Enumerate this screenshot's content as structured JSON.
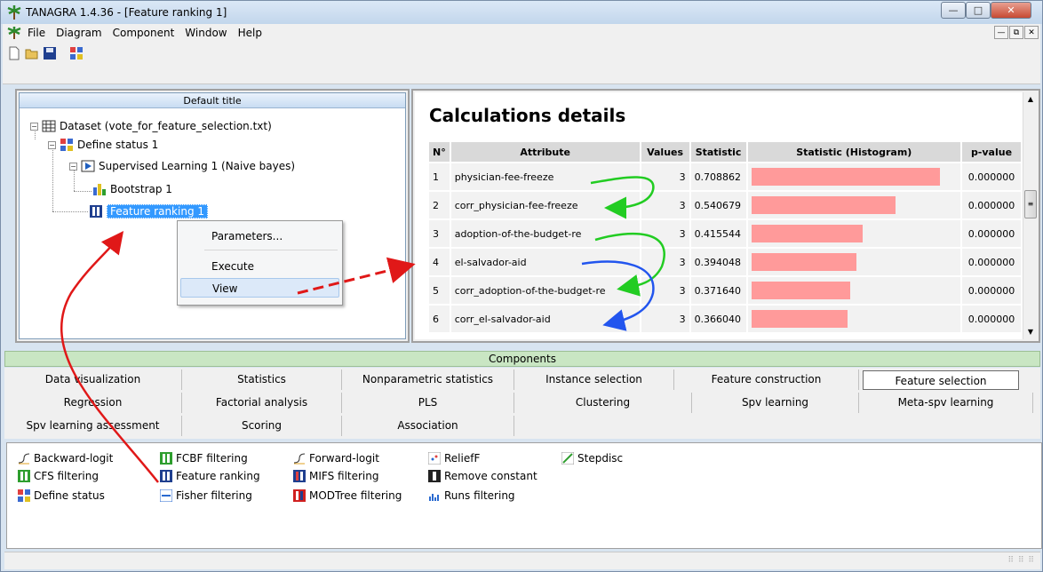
{
  "window": {
    "title": "TANAGRA 1.4.36 - [Feature ranking 1]"
  },
  "menu": {
    "items": [
      "File",
      "Diagram",
      "Component",
      "Window",
      "Help"
    ]
  },
  "tree": {
    "header": "Default title",
    "nodes": [
      {
        "label": "Dataset (vote_for_feature_selection.txt)"
      },
      {
        "label": "Define status 1"
      },
      {
        "label": "Supervised Learning 1 (Naive bayes)"
      },
      {
        "label": "Bootstrap 1"
      },
      {
        "label": "Feature ranking 1"
      }
    ]
  },
  "context_menu": {
    "items": [
      "Parameters...",
      "Execute",
      "View"
    ]
  },
  "details": {
    "title": "Calculations details",
    "columns": [
      "N°",
      "Attribute",
      "Values",
      "Statistic",
      "Statistic (Histogram)",
      "p-value"
    ],
    "rows": [
      {
        "n": "1",
        "attribute": "physician-fee-freeze",
        "values": "3",
        "statistic": "0.708862",
        "hist_fraction": 0.92,
        "pvalue": "0.000000"
      },
      {
        "n": "2",
        "attribute": "corr_physician-fee-freeze",
        "values": "3",
        "statistic": "0.540679",
        "hist_fraction": 0.7,
        "pvalue": "0.000000"
      },
      {
        "n": "3",
        "attribute": "adoption-of-the-budget-re",
        "values": "3",
        "statistic": "0.415544",
        "hist_fraction": 0.54,
        "pvalue": "0.000000"
      },
      {
        "n": "4",
        "attribute": "el-salvador-aid",
        "values": "3",
        "statistic": "0.394048",
        "hist_fraction": 0.51,
        "pvalue": "0.000000"
      },
      {
        "n": "5",
        "attribute": "corr_adoption-of-the-budget-re",
        "values": "3",
        "statistic": "0.371640",
        "hist_fraction": 0.48,
        "pvalue": "0.000000"
      },
      {
        "n": "6",
        "attribute": "corr_el-salvador-aid",
        "values": "3",
        "statistic": "0.366040",
        "hist_fraction": 0.47,
        "pvalue": "0.000000"
      }
    ]
  },
  "components": {
    "header": "Components",
    "tabs_row1": [
      "Data visualization",
      "Statistics",
      "Nonparametric statistics",
      "Instance selection",
      "Feature construction",
      "Feature selection"
    ],
    "tabs_row2": [
      "Regression",
      "Factorial analysis",
      "PLS",
      "Clustering",
      "Spv learning",
      "Meta-spv learning"
    ],
    "tabs_row3": [
      "Spv learning assessment",
      "Scoring",
      "Association"
    ],
    "items": [
      "Backward-logit",
      "CFS filtering",
      "Define status",
      "FCBF filtering",
      "Feature ranking",
      "Fisher filtering",
      "Forward-logit",
      "MIFS filtering",
      "MODTree filtering",
      "ReliefF",
      "Remove constant",
      "Runs filtering",
      "Stepdisc"
    ]
  },
  "colors": {
    "hist_bar": "#ff9a9a",
    "selection": "#3399ff",
    "components_header": "#c9e6c3"
  }
}
